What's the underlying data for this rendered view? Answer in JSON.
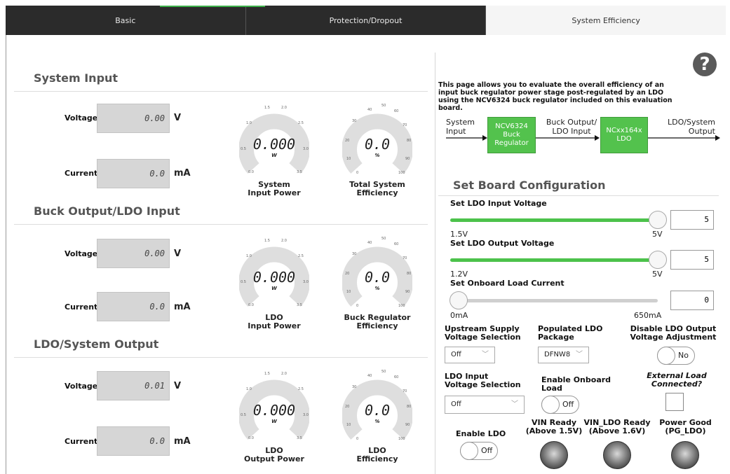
{
  "tabs": [
    {
      "label": "Basic"
    },
    {
      "label": "Protection/Dropout"
    },
    {
      "label": "System Efficiency"
    }
  ],
  "sections": {
    "system_input": {
      "title": "System Input",
      "voltage": "0.00",
      "current": "0.0"
    },
    "buck_output": {
      "title": "Buck Output/LDO Input",
      "voltage": "0.00",
      "current": "0.0"
    },
    "ldo_output": {
      "title": "LDO/System Output",
      "voltage": "0.01",
      "current": "0.0"
    }
  },
  "labels": {
    "voltage": "Voltage",
    "current": "Current",
    "unit_v": "V",
    "unit_ma": "mA"
  },
  "gauges": {
    "power_ticks": [
      "1.5",
      "2.0",
      "1.0",
      "2.5",
      "0.5",
      "3.0",
      "0.0",
      "3.5"
    ],
    "eff_ticks": [
      "40",
      "50",
      "60",
      "30",
      "70",
      "20",
      "80",
      "10",
      "90",
      "0",
      "100"
    ],
    "system_power": {
      "value": "0.000",
      "unit": "W",
      "caption1": "System",
      "caption2": "Input Power"
    },
    "total_eff": {
      "value": "0.0",
      "unit": "%",
      "caption1": "Total System",
      "caption2": "Efficiency"
    },
    "ldo_in_power": {
      "value": "0.000",
      "unit": "W",
      "caption1": "LDO",
      "caption2": "Input Power"
    },
    "buck_eff": {
      "value": "0.0",
      "unit": "%",
      "caption1": "Buck Regulator",
      "caption2": "Efficiency"
    },
    "ldo_out_power": {
      "value": "0.000",
      "unit": "W",
      "caption1": "LDO",
      "caption2": "Output Power"
    },
    "ldo_eff": {
      "value": "0.0",
      "unit": "%",
      "caption1": "LDO",
      "caption2": "Efficiency"
    }
  },
  "description": {
    "line1": "This page allows you to evaluate the overall efficiency of an",
    "line2": "input buck regulator power stage post-regulated by an LDO",
    "line3": "using the NCV6324 buck regulator included on this evaluation board."
  },
  "help": {
    "glyph": "?"
  },
  "diagram": {
    "system_input_1": "System",
    "system_input_2": "Input",
    "buck_box_1": "NCV6324",
    "buck_box_2": "Buck",
    "buck_box_3": "Regulator",
    "mid_1": "Buck Output/",
    "mid_2": "LDO Input",
    "ldo_box_1": "NCxx164x",
    "ldo_box_2": "LDO",
    "out_1": "LDO/System",
    "out_2": "Output"
  },
  "board": {
    "title": "Set Board Configuration",
    "ldo_in": {
      "label": "Set LDO Input Voltage",
      "min": "1.5V",
      "max": "5V",
      "value": "5",
      "fraction": 1.0
    },
    "ldo_out": {
      "label": "Set LDO Output Voltage",
      "min": "1.2V",
      "max": "5V",
      "value": "5",
      "fraction": 1.0
    },
    "load": {
      "label": "Set Onboard Load Current",
      "min": "0mA",
      "max": "650mA",
      "value": "0",
      "fraction": 0.0
    },
    "upstream": {
      "label1": "Upstream Supply",
      "label2": "Voltage Selection",
      "value": "Off"
    },
    "package": {
      "label1": "Populated LDO",
      "label2": "Package",
      "value": "DFNW8"
    },
    "disable_adj": {
      "label1": "Disable LDO Output",
      "label2": "Voltage Adjustment",
      "state": "No"
    },
    "ldo_input_sel": {
      "label1": "LDO Input",
      "label2": "Voltage Selection",
      "value": "Off"
    },
    "enable_load": {
      "label1": "Enable Onboard",
      "label2": "Load",
      "state": "Off"
    },
    "ext_load": {
      "label1": "External Load",
      "label2": "Connected?"
    },
    "enable_ldo": {
      "label": "Enable LDO",
      "state": "Off"
    },
    "vin_ready": {
      "label1": "VIN Ready",
      "label2": "(Above 1.5V)"
    },
    "vin_ldo_ready": {
      "label1": "VIN_LDO Ready",
      "label2": "(Above 1.6V)"
    },
    "power_good": {
      "label1": "Power Good",
      "label2": "(PG_LDO)"
    }
  },
  "icons": {
    "chevron": "chevron-down-icon"
  }
}
